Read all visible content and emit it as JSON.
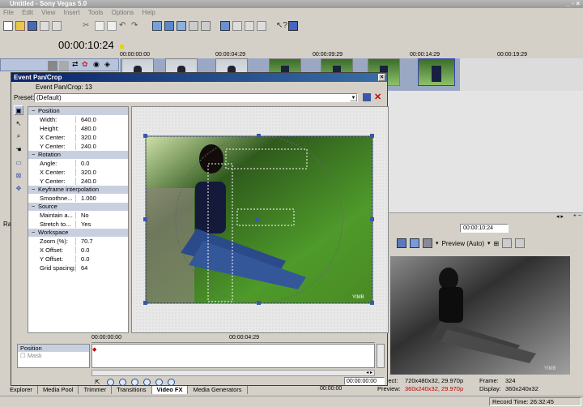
{
  "app": {
    "title": "Untitled - Sony Vegas 5.0",
    "accent": "#0a246a"
  },
  "menu": [
    "File",
    "Edit",
    "View",
    "Insert",
    "Tools",
    "Options",
    "Help"
  ],
  "timeline": {
    "timecode": "00:00:10:24",
    "ruler": [
      "00:00:00:00",
      "00:00:04:29",
      "00:00:09:29",
      "00:00:14:29",
      "00:00:19:29"
    ],
    "cursor_time": "00:00:10:24"
  },
  "pan_crop": {
    "window_title": "Event Pan/Crop",
    "header": "Event Pan/Crop: 13",
    "preset_label": "Preset:",
    "preset_value": "(Default)",
    "groups": [
      {
        "name": "Position",
        "rows": [
          [
            "Width:",
            "640.0"
          ],
          [
            "Height:",
            "480.0"
          ],
          [
            "X Center:",
            "320.0"
          ],
          [
            "Y Center:",
            "240.0"
          ]
        ]
      },
      {
        "name": "Rotation",
        "rows": [
          [
            "Angle:",
            "0.0"
          ],
          [
            "X Center:",
            "320.0"
          ],
          [
            "Y Center:",
            "240.0"
          ]
        ]
      },
      {
        "name": "Keyframe interpolation",
        "rows": [
          [
            "Smoothne...",
            "1.000"
          ]
        ]
      },
      {
        "name": "Source",
        "rows": [
          [
            "Maintain a...",
            "No"
          ],
          [
            "Stretch to...",
            "Yes"
          ]
        ]
      },
      {
        "name": "Workspace",
        "rows": [
          [
            "Zoom (%):",
            "70.7"
          ],
          [
            "X Offset:",
            "0.0"
          ],
          [
            "Y Offset:",
            "0.0"
          ],
          [
            "Grid spacing:",
            "64"
          ]
        ]
      }
    ],
    "watermark": "YIMB",
    "kf_start": "00:00:00:00",
    "kf_mid": "00:00:04:29",
    "kf_tracks": [
      "Position",
      "Mask"
    ],
    "kf_time": "00:00:00:00"
  },
  "left_letters": "Ra",
  "preview": {
    "label": "Preview (Auto)",
    "info": {
      "project_label": "Project:",
      "project_value": "720x480x32, 29.970p",
      "preview_label": "Preview:",
      "preview_value": "360x240x32, 29.970p",
      "frame_label": "Frame:",
      "frame_value": "324",
      "display_label": "Display:",
      "display_value": "360x240x32"
    }
  },
  "bottom_tabs": [
    "Explorer",
    "Media Pool",
    "Trimmer",
    "Transitions",
    "Video FX",
    "Media Generators"
  ],
  "record_time": "Record Time: 26:32:45",
  "small_time": "00:00:00"
}
